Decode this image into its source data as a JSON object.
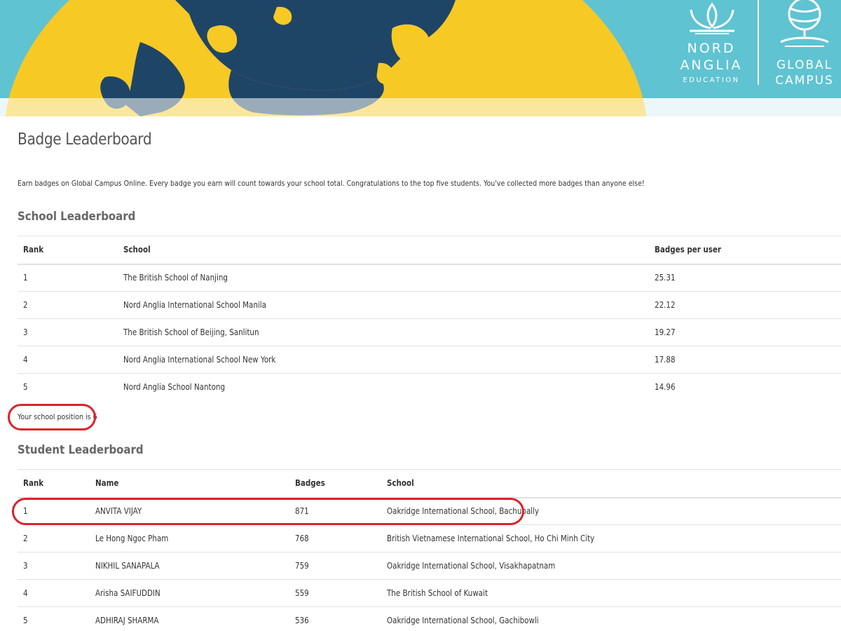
{
  "brand": {
    "nord_line1": "NORD",
    "nord_line2": "ANGLIA",
    "nord_line3": "EDUCATION",
    "global_line1": "GLOBAL",
    "global_line2": "CAMPUS"
  },
  "colors": {
    "banner_sky": "#5fc3d2",
    "globe_yellow": "#f7c925",
    "ocean_navy": "#1f4566",
    "highlight_red": "#d9232b"
  },
  "page": {
    "title": "Badge Leaderboard",
    "intro": "Earn badges on Global Campus Online. Every badge you earn will count towards your school total. Congratulations to the top five students. You've collected more badges than anyone else!"
  },
  "school_leaderboard": {
    "title": "School Leaderboard",
    "headers": {
      "rank": "Rank",
      "school": "School",
      "badges_per_user": "Badges per user"
    },
    "rows": [
      {
        "rank": "1",
        "school": "The British School of Nanjing",
        "badges_per_user": "25.31"
      },
      {
        "rank": "2",
        "school": "Nord Anglia International School Manila",
        "badges_per_user": "22.12"
      },
      {
        "rank": "3",
        "school": "The British School of Beijing, Sanlitun",
        "badges_per_user": "19.27"
      },
      {
        "rank": "4",
        "school": "Nord Anglia International School New York",
        "badges_per_user": "17.88"
      },
      {
        "rank": "5",
        "school": "Nord Anglia School Nantong",
        "badges_per_user": "14.96"
      }
    ],
    "position_note": "Your school position is 6"
  },
  "student_leaderboard": {
    "title": "Student Leaderboard",
    "headers": {
      "rank": "Rank",
      "name": "Name",
      "badges": "Badges",
      "school": "School"
    },
    "rows": [
      {
        "rank": "1",
        "name": "ANVITA VIJAY",
        "badges": "871",
        "school": "Oakridge International School, Bachupally"
      },
      {
        "rank": "2",
        "name": "Le Hong Ngoc Pham",
        "badges": "768",
        "school": "British Vietnamese International School, Ho Chi Minh City"
      },
      {
        "rank": "3",
        "name": "NIKHIL SANAPALA",
        "badges": "759",
        "school": "Oakridge International School, Visakhapatnam"
      },
      {
        "rank": "4",
        "name": "Arisha SAIFUDDIN",
        "badges": "559",
        "school": "The British School of Kuwait"
      },
      {
        "rank": "5",
        "name": "ADHIRAJ SHARMA",
        "badges": "536",
        "school": "Oakridge International School, Gachibowli"
      }
    ]
  }
}
